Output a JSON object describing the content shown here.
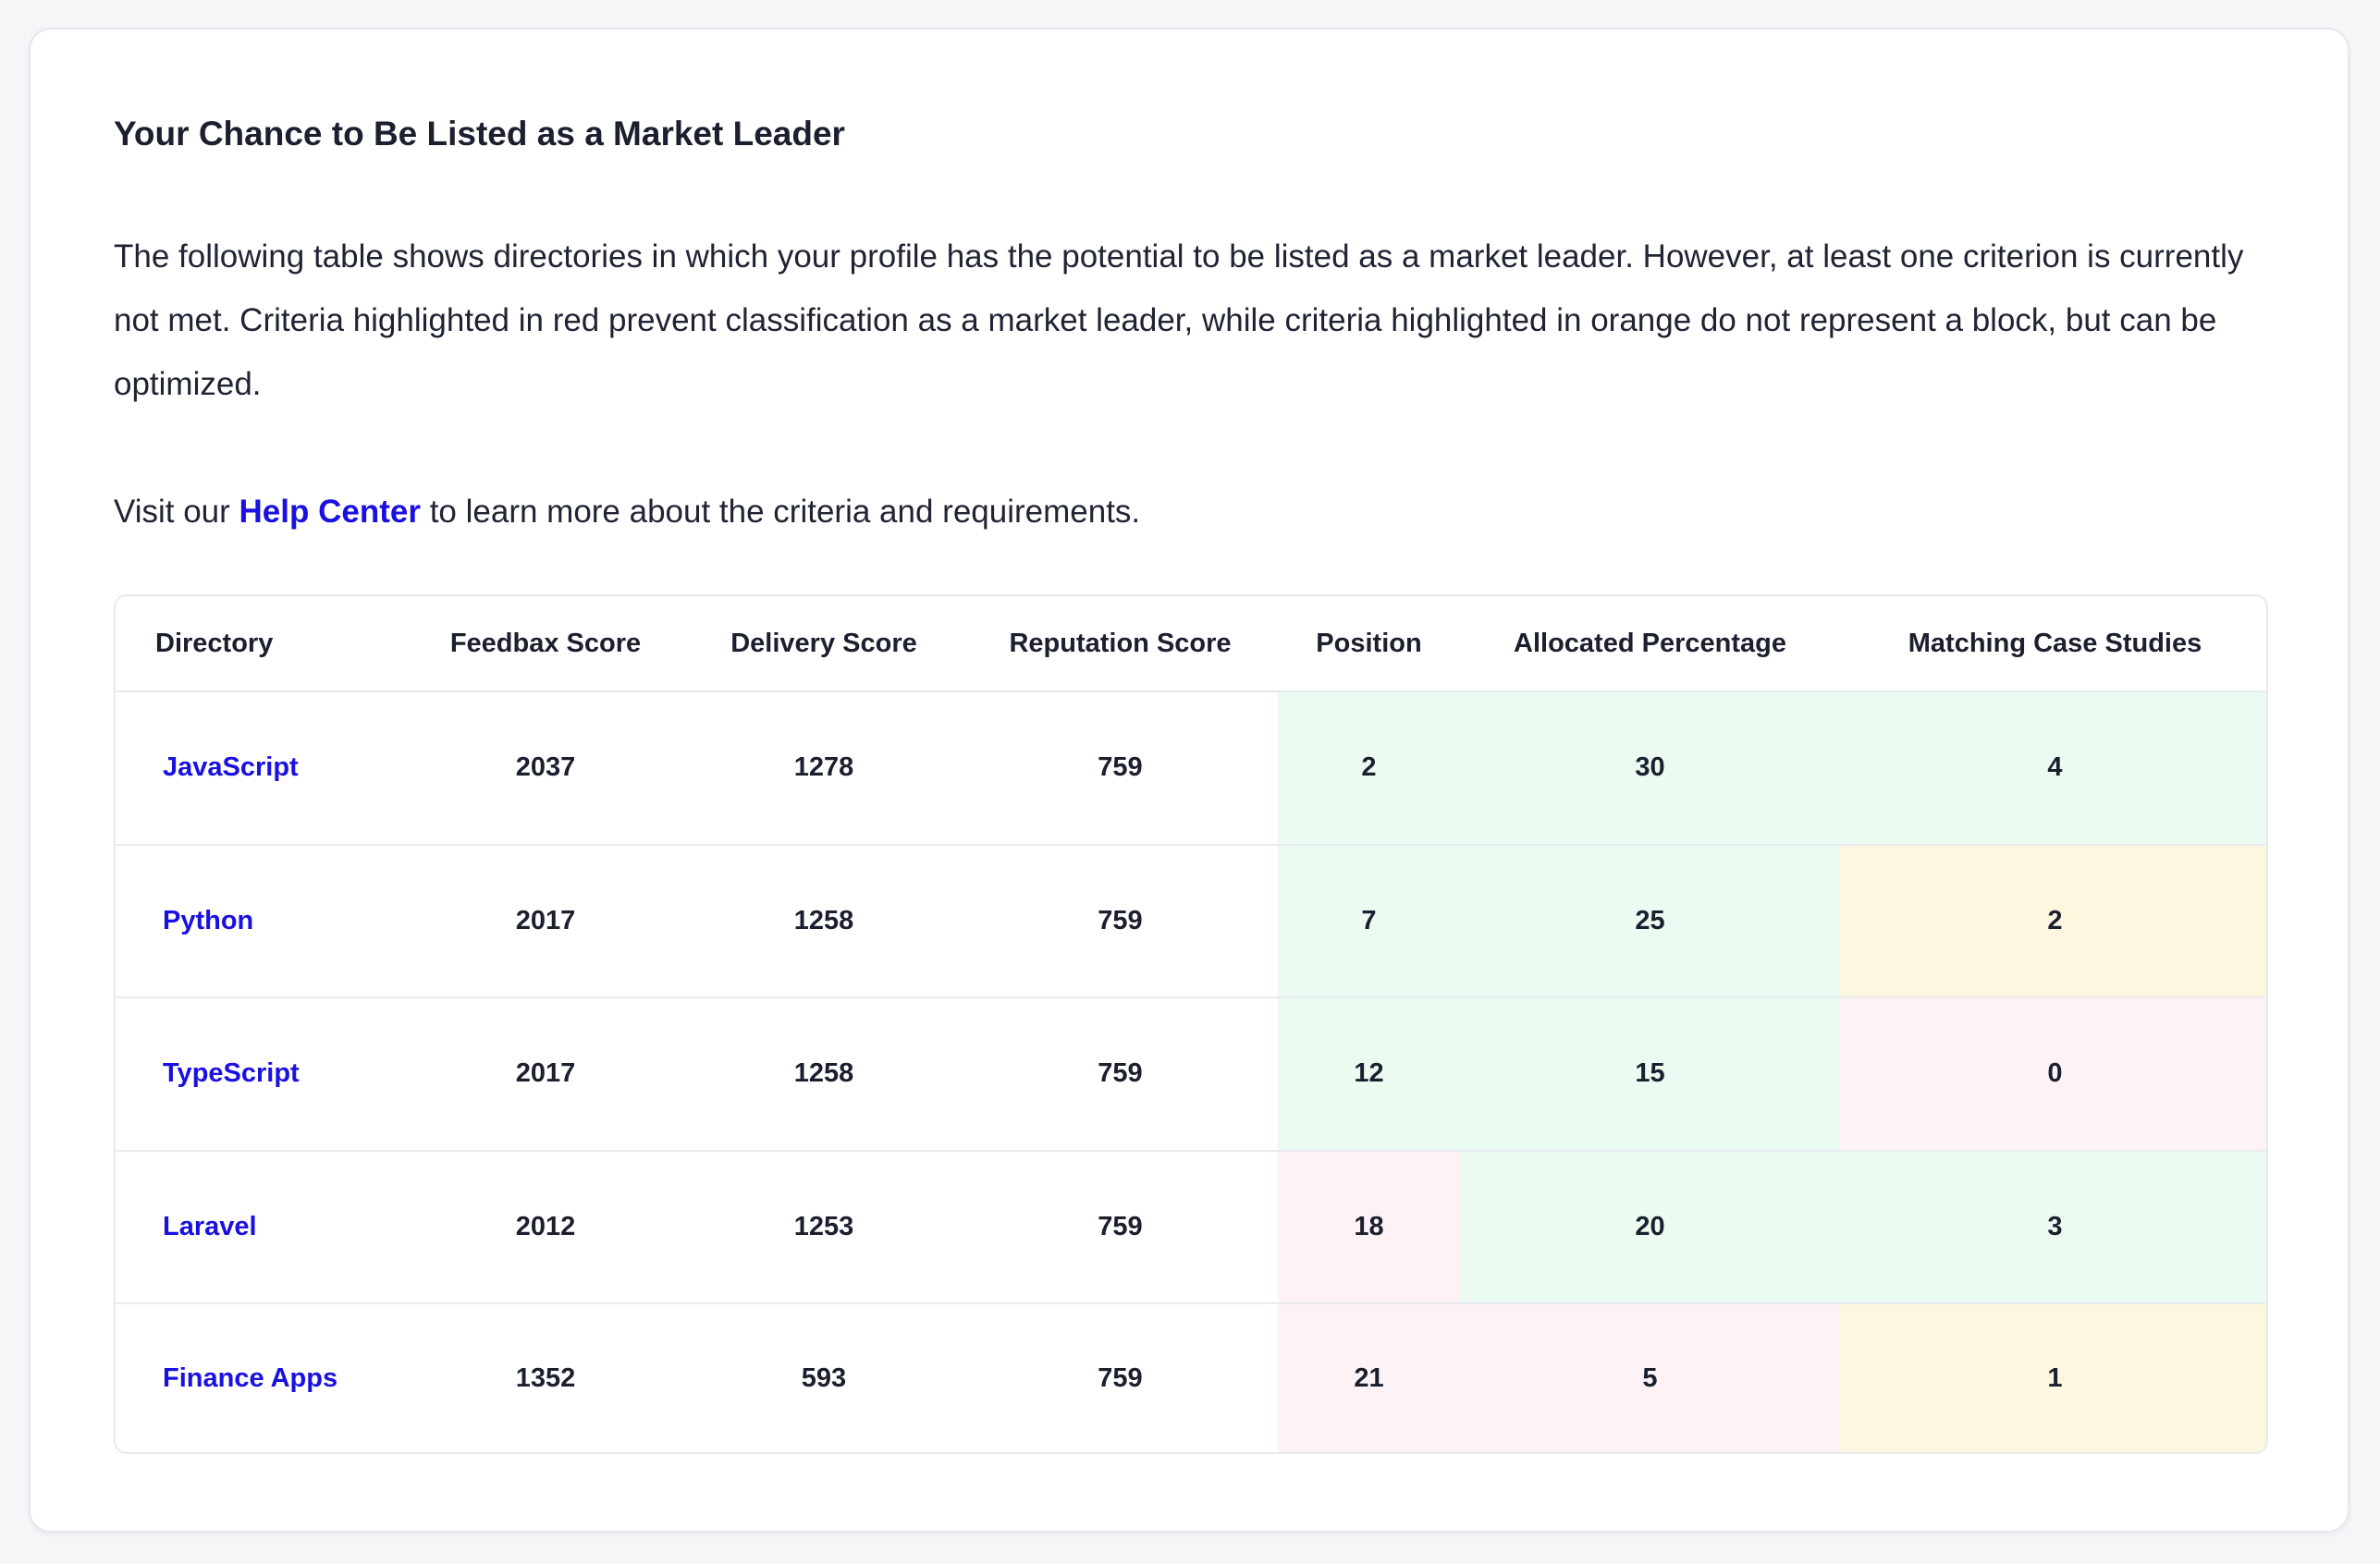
{
  "header": {
    "title": "Your Chance to Be Listed as a Market Leader",
    "description": "The following table shows directories in which your profile has the potential to be listed as a market leader. However, at least one criterion is currently not met. Criteria highlighted in red prevent classification as a market leader, while criteria highlighted in orange do not represent a block, but can be optimized.",
    "help_prefix": "Visit our ",
    "help_link": "Help Center",
    "help_suffix": " to learn more about the criteria and requirements."
  },
  "colors": {
    "link": "#1a10e0",
    "met": "#ebfbf1",
    "optimizable": "#fdf7e0",
    "blocking": "#fdf3f6"
  },
  "table": {
    "columns": [
      "Directory",
      "Feedbax Score",
      "Delivery Score",
      "Reputation Score",
      "Position",
      "Allocated Percentage",
      "Matching Case Studies"
    ],
    "rows": [
      {
        "directory": "JavaScript",
        "cells": [
          {
            "value": "2037",
            "status": "none"
          },
          {
            "value": "1278",
            "status": "none"
          },
          {
            "value": "759",
            "status": "none"
          },
          {
            "value": "2",
            "status": "green"
          },
          {
            "value": "30",
            "status": "green"
          },
          {
            "value": "4",
            "status": "green"
          }
        ]
      },
      {
        "directory": "Python",
        "cells": [
          {
            "value": "2017",
            "status": "none"
          },
          {
            "value": "1258",
            "status": "none"
          },
          {
            "value": "759",
            "status": "none"
          },
          {
            "value": "7",
            "status": "green"
          },
          {
            "value": "25",
            "status": "green"
          },
          {
            "value": "2",
            "status": "orange"
          }
        ]
      },
      {
        "directory": "TypeScript",
        "cells": [
          {
            "value": "2017",
            "status": "none"
          },
          {
            "value": "1258",
            "status": "none"
          },
          {
            "value": "759",
            "status": "none"
          },
          {
            "value": "12",
            "status": "green"
          },
          {
            "value": "15",
            "status": "green"
          },
          {
            "value": "0",
            "status": "red"
          }
        ]
      },
      {
        "directory": "Laravel",
        "cells": [
          {
            "value": "2012",
            "status": "none"
          },
          {
            "value": "1253",
            "status": "none"
          },
          {
            "value": "759",
            "status": "none"
          },
          {
            "value": "18",
            "status": "red"
          },
          {
            "value": "20",
            "status": "green"
          },
          {
            "value": "3",
            "status": "green"
          }
        ]
      },
      {
        "directory": "Finance Apps",
        "cells": [
          {
            "value": "1352",
            "status": "none"
          },
          {
            "value": "593",
            "status": "none"
          },
          {
            "value": "759",
            "status": "none"
          },
          {
            "value": "21",
            "status": "red"
          },
          {
            "value": "5",
            "status": "red"
          },
          {
            "value": "1",
            "status": "orange"
          }
        ]
      }
    ]
  }
}
